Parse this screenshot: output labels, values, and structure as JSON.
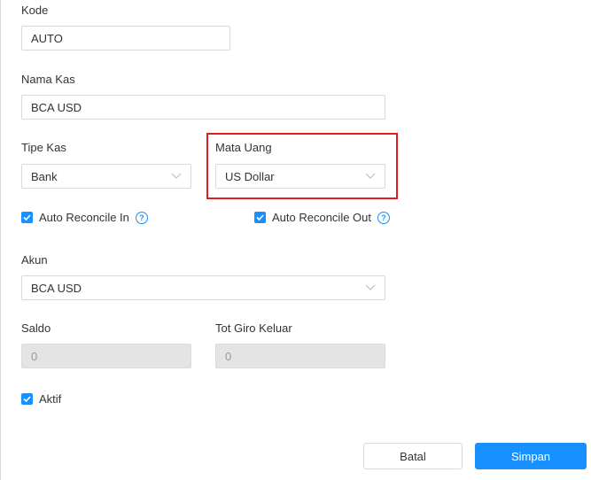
{
  "form": {
    "kode": {
      "label": "Kode",
      "value": "AUTO"
    },
    "nama_kas": {
      "label": "Nama Kas",
      "value": "BCA USD"
    },
    "tipe_kas": {
      "label": "Tipe Kas",
      "value": "Bank"
    },
    "mata_uang": {
      "label": "Mata Uang",
      "value": "US Dollar"
    },
    "auto_reconcile_in": {
      "label": "Auto Reconcile In",
      "checked": true
    },
    "auto_reconcile_out": {
      "label": "Auto Reconcile Out",
      "checked": true
    },
    "akun": {
      "label": "Akun",
      "value": "BCA USD"
    },
    "saldo": {
      "label": "Saldo",
      "value": "0"
    },
    "tot_giro_keluar": {
      "label": "Tot Giro Keluar",
      "value": "0"
    },
    "aktif": {
      "label": "Aktif",
      "checked": true
    }
  },
  "actions": {
    "cancel_label": "Batal",
    "save_label": "Simpan"
  },
  "colors": {
    "primary": "#1890ff",
    "highlight": "#e01b1b",
    "disabled_bg": "#e4e4e4"
  },
  "icons": {
    "chevron": "chevron-down-icon",
    "help": "help-circle-icon",
    "check": "check-icon"
  }
}
